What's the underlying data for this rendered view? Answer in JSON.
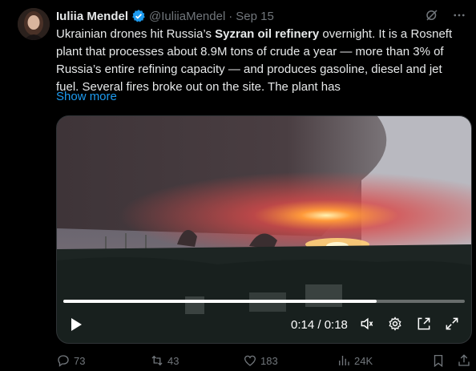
{
  "author": {
    "name": "Iuliia Mendel",
    "handle": "@IuliiaMendel",
    "separator": "·",
    "date": "Sep 15"
  },
  "post": {
    "text_1": "Ukrainian drones hit Russia’s ",
    "text_bold": "Syzran oil refinery",
    "text_2": " overnight. It is a Rosneft plant that processes about 8.9M tons of crude a year — more than 3% of Russia’s entire refining capacity — and produces gasoline, diesel and jet fuel. Several fires broke out on the site. The plant has",
    "show_more": "Show more"
  },
  "video": {
    "time": "0:14 / 0:18",
    "progress": 0.78
  },
  "actions": {
    "replies": "73",
    "reposts": "43",
    "likes": "183",
    "views": "24K"
  },
  "colors": {
    "accent": "#1d9bf0",
    "muted": "#71767b",
    "text": "#e7e9ea",
    "background": "#000000"
  }
}
